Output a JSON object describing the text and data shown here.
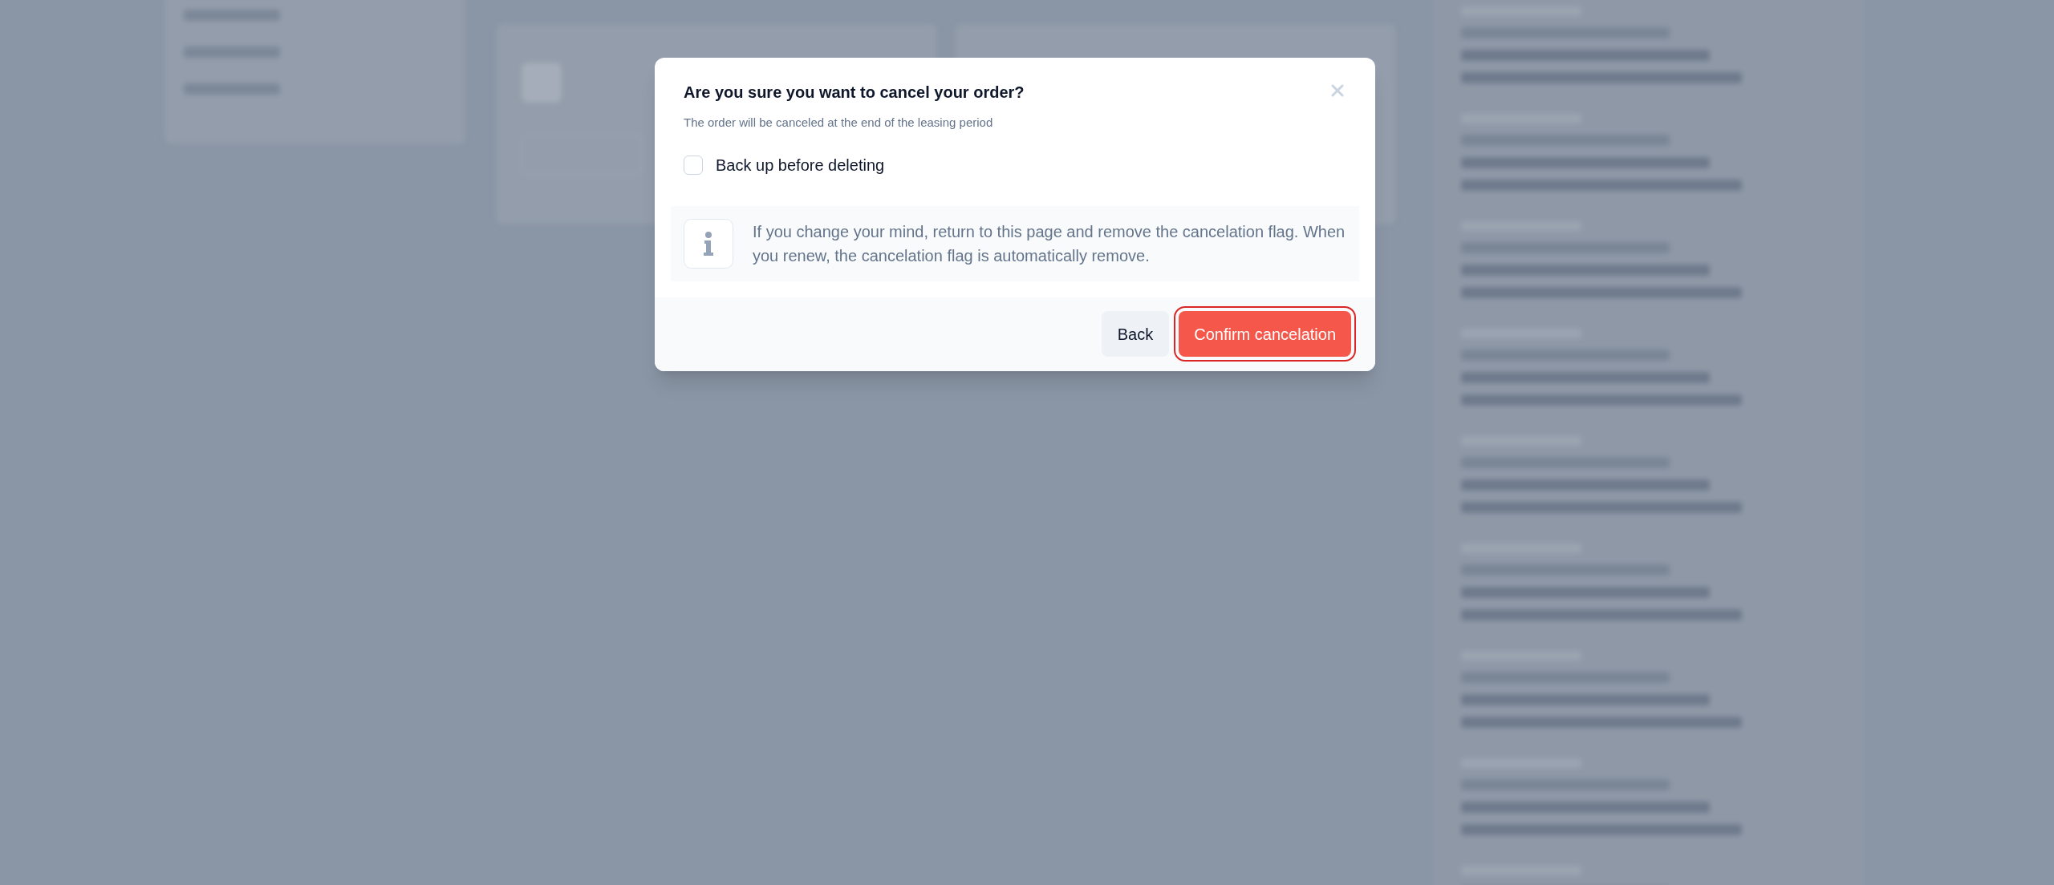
{
  "dialog": {
    "title": "Are you sure you want to cancel your order?",
    "subtitle": "The order will be canceled at the end of the leasing period",
    "checkbox": {
      "label": "Back up before deleting",
      "checked": false
    },
    "info": {
      "text": "If you change your mind, return to this page and remove the cancelation flag. When you renew, the cancelation flag is automatically remove."
    },
    "buttons": [
      {
        "label": "Back",
        "kind": "secondary",
        "highlighted": false
      },
      {
        "label": "Confirm cancelation",
        "kind": "danger",
        "highlighted": true
      }
    ]
  }
}
